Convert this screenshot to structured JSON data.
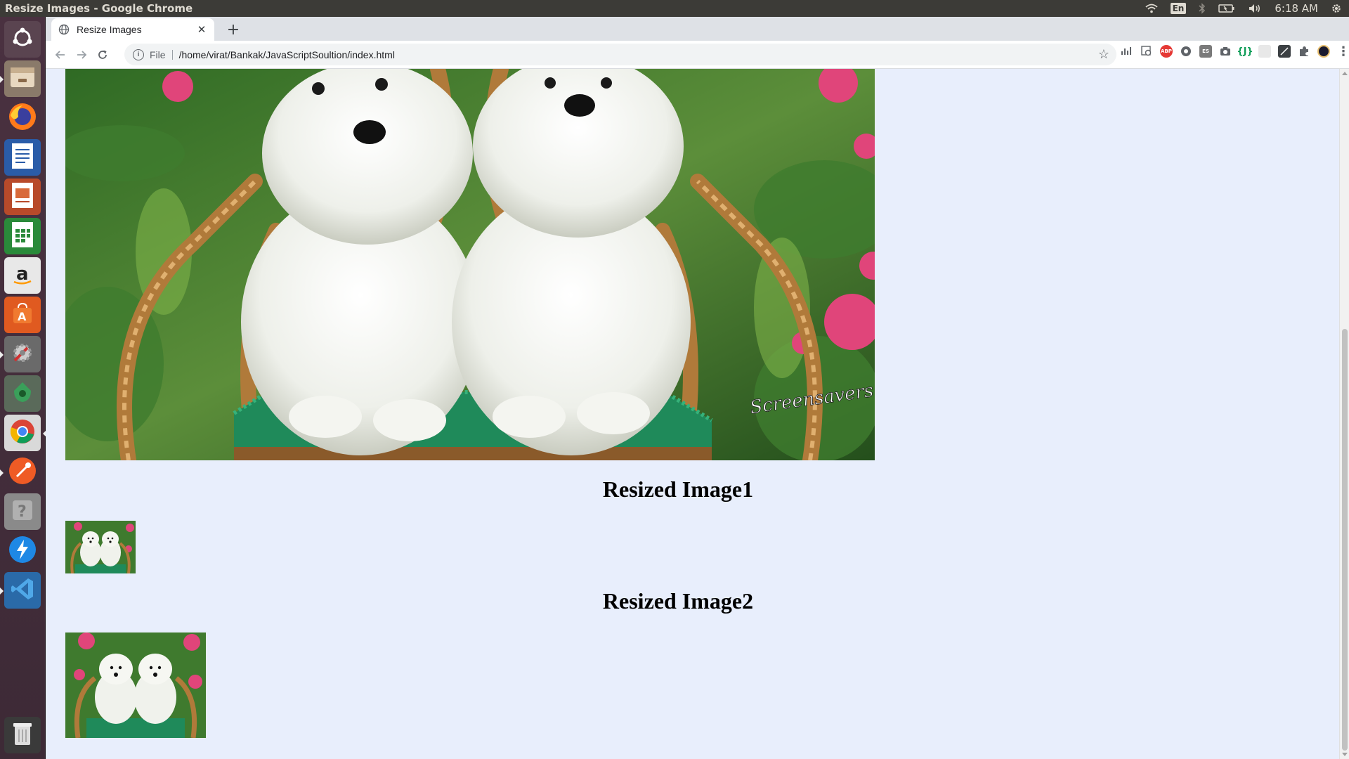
{
  "system_bar": {
    "window_title": "Resize Images - Google Chrome",
    "keyboard_layout": "En",
    "clock": "6:18 AM"
  },
  "launcher": {
    "items": [
      {
        "name": "ubuntu-dash",
        "icon": "ubuntu-logo-icon"
      },
      {
        "name": "files",
        "icon": "file-manager-icon"
      },
      {
        "name": "firefox",
        "icon": "firefox-icon"
      },
      {
        "name": "libreoffice-writer",
        "icon": "writer-icon"
      },
      {
        "name": "libreoffice-impress",
        "icon": "impress-icon"
      },
      {
        "name": "libreoffice-calc",
        "icon": "calc-icon"
      },
      {
        "name": "amazon",
        "icon": "amazon-icon"
      },
      {
        "name": "software-center",
        "icon": "software-center-icon"
      },
      {
        "name": "system-settings",
        "icon": "settings-icon"
      },
      {
        "name": "pidgin",
        "icon": "app-icon"
      },
      {
        "name": "google-chrome",
        "icon": "chrome-icon"
      },
      {
        "name": "postman",
        "icon": "postman-icon"
      },
      {
        "name": "help",
        "icon": "help-icon"
      },
      {
        "name": "zeal",
        "icon": "bolt-icon"
      },
      {
        "name": "vscode",
        "icon": "vscode-icon"
      },
      {
        "name": "trash",
        "icon": "trash-icon"
      }
    ]
  },
  "browser": {
    "tab": {
      "title": "Resize Images"
    },
    "address": {
      "scheme_label": "File",
      "url": "/home/virat/Bankak/JavaScriptSoultion/index.html"
    }
  },
  "page": {
    "watermark": "Screensavers.com",
    "sections": [
      {
        "heading": "Resized Image1"
      },
      {
        "heading": "Resized Image2"
      }
    ]
  },
  "colors": {
    "page_background": "#e8eefc",
    "ubuntu_panel": "#3c3b37",
    "launcher": "#4a3140",
    "chrome_frame": "#dee1e6"
  }
}
